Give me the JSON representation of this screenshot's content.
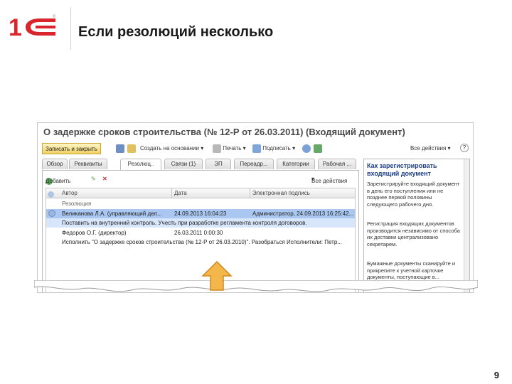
{
  "slide": {
    "title": "Если резолюций несколько",
    "page_number": "9"
  },
  "window": {
    "title": "О задержке сроков строительства (№ 12-Р от 26.03.2011) (Входящий документ)"
  },
  "toolbar": {
    "save_close": "Записать и закрыть",
    "create_based": "Создать на основании",
    "print": "Печать",
    "sign": "Подписать",
    "all_actions": "Все действия",
    "help": "?"
  },
  "tabs": [
    {
      "label": "Обзор"
    },
    {
      "label": "Реквизиты"
    },
    {
      "label": "Резолюц.."
    },
    {
      "label": "Связи (1)"
    },
    {
      "label": "ЭП"
    },
    {
      "label": "Переадр..."
    },
    {
      "label": "Категории"
    },
    {
      "label": "Рабочая ..."
    }
  ],
  "resolutions": {
    "add": "Добавить",
    "all_actions": "Все действия",
    "columns": {
      "author": "Автор",
      "date": "Дата",
      "signature": "Электронная подпись"
    },
    "group_label": "Резолюция",
    "rows": [
      {
        "author": "Великанова Л.А. (управляющий дел...",
        "date": "24.09.2013 16:04:23",
        "signature": "Администратор, 24.09.2013 16:25:42..."
      },
      {
        "text": "Поставить на внутренний контроль. Учесть при разработке регламента контроля договоров."
      },
      {
        "author": "Федоров О.Г. (директор)",
        "date": "26.03.2011 0:00:30",
        "signature": ""
      },
      {
        "text": "Исполнить \"О задержке сроков строительства (№ 12-Р от 26.03.2010)\". Разобраться Исполнители: Петр..."
      }
    ]
  },
  "help_panel": {
    "heading": "Как зарегистрировать входящий документ",
    "paragraphs": [
      "Зарегистрируйте входящий документ в день его поступления или не позднее первой половины следующего рабочего дня.",
      "Регистрация входящих документов производится независимо от способа их доставки централизовано секретарем.",
      "Бумажные документы сканируйте и прикрепите к учетной карточке документы, поступающие в..."
    ]
  },
  "colors": {
    "selected_row": "#a9c7f0",
    "logo_red": "#d8262c",
    "arrow": "#f2b64a"
  }
}
